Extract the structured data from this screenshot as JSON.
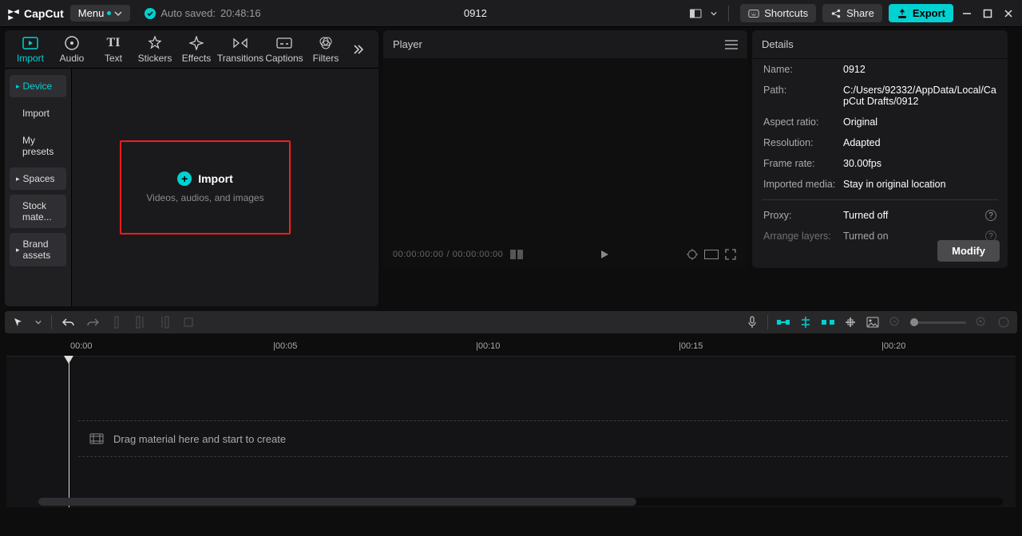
{
  "titlebar": {
    "brand": "CapCut",
    "menu": "Menu",
    "autosaved_prefix": "Auto saved:",
    "autosaved_time": "20:48:16",
    "project_name": "0912",
    "shortcuts": "Shortcuts",
    "share": "Share",
    "export": "Export"
  },
  "tabs": [
    {
      "label": "Import"
    },
    {
      "label": "Audio"
    },
    {
      "label": "Text"
    },
    {
      "label": "Stickers"
    },
    {
      "label": "Effects"
    },
    {
      "label": "Transitions"
    },
    {
      "label": "Captions"
    },
    {
      "label": "Filters"
    }
  ],
  "sidebar": {
    "items": [
      {
        "label": "Device",
        "active": true,
        "chev": true
      },
      {
        "label": "Import"
      },
      {
        "label": "My presets"
      },
      {
        "label": "Spaces",
        "box": true,
        "chev": true
      },
      {
        "label": "Stock mate...",
        "box": true
      },
      {
        "label": "Brand assets",
        "box": true,
        "chev": true
      }
    ]
  },
  "import_area": {
    "title": "Import",
    "subtitle": "Videos, audios, and images"
  },
  "player": {
    "title": "Player",
    "time_current": "00:00:00:00",
    "time_total": "00:00:00:00"
  },
  "details": {
    "title": "Details",
    "name_label": "Name:",
    "name_val": "0912",
    "path_label": "Path:",
    "path_val": "C:/Users/92332/AppData/Local/CapCut Drafts/0912",
    "aspect_label": "Aspect ratio:",
    "aspect_val": "Original",
    "resolution_label": "Resolution:",
    "resolution_val": "Adapted",
    "framerate_label": "Frame rate:",
    "framerate_val": "30.00fps",
    "imported_label": "Imported media:",
    "imported_val": "Stay in original location",
    "proxy_label": "Proxy:",
    "proxy_val": "Turned off",
    "arrange_label": "Arrange layers:",
    "arrange_val": "Turned on",
    "modify": "Modify"
  },
  "timeline": {
    "marks": [
      "00:00",
      "00:05",
      "00:10",
      "00:15",
      "00:20"
    ],
    "hint": "Drag material here and start to create"
  }
}
